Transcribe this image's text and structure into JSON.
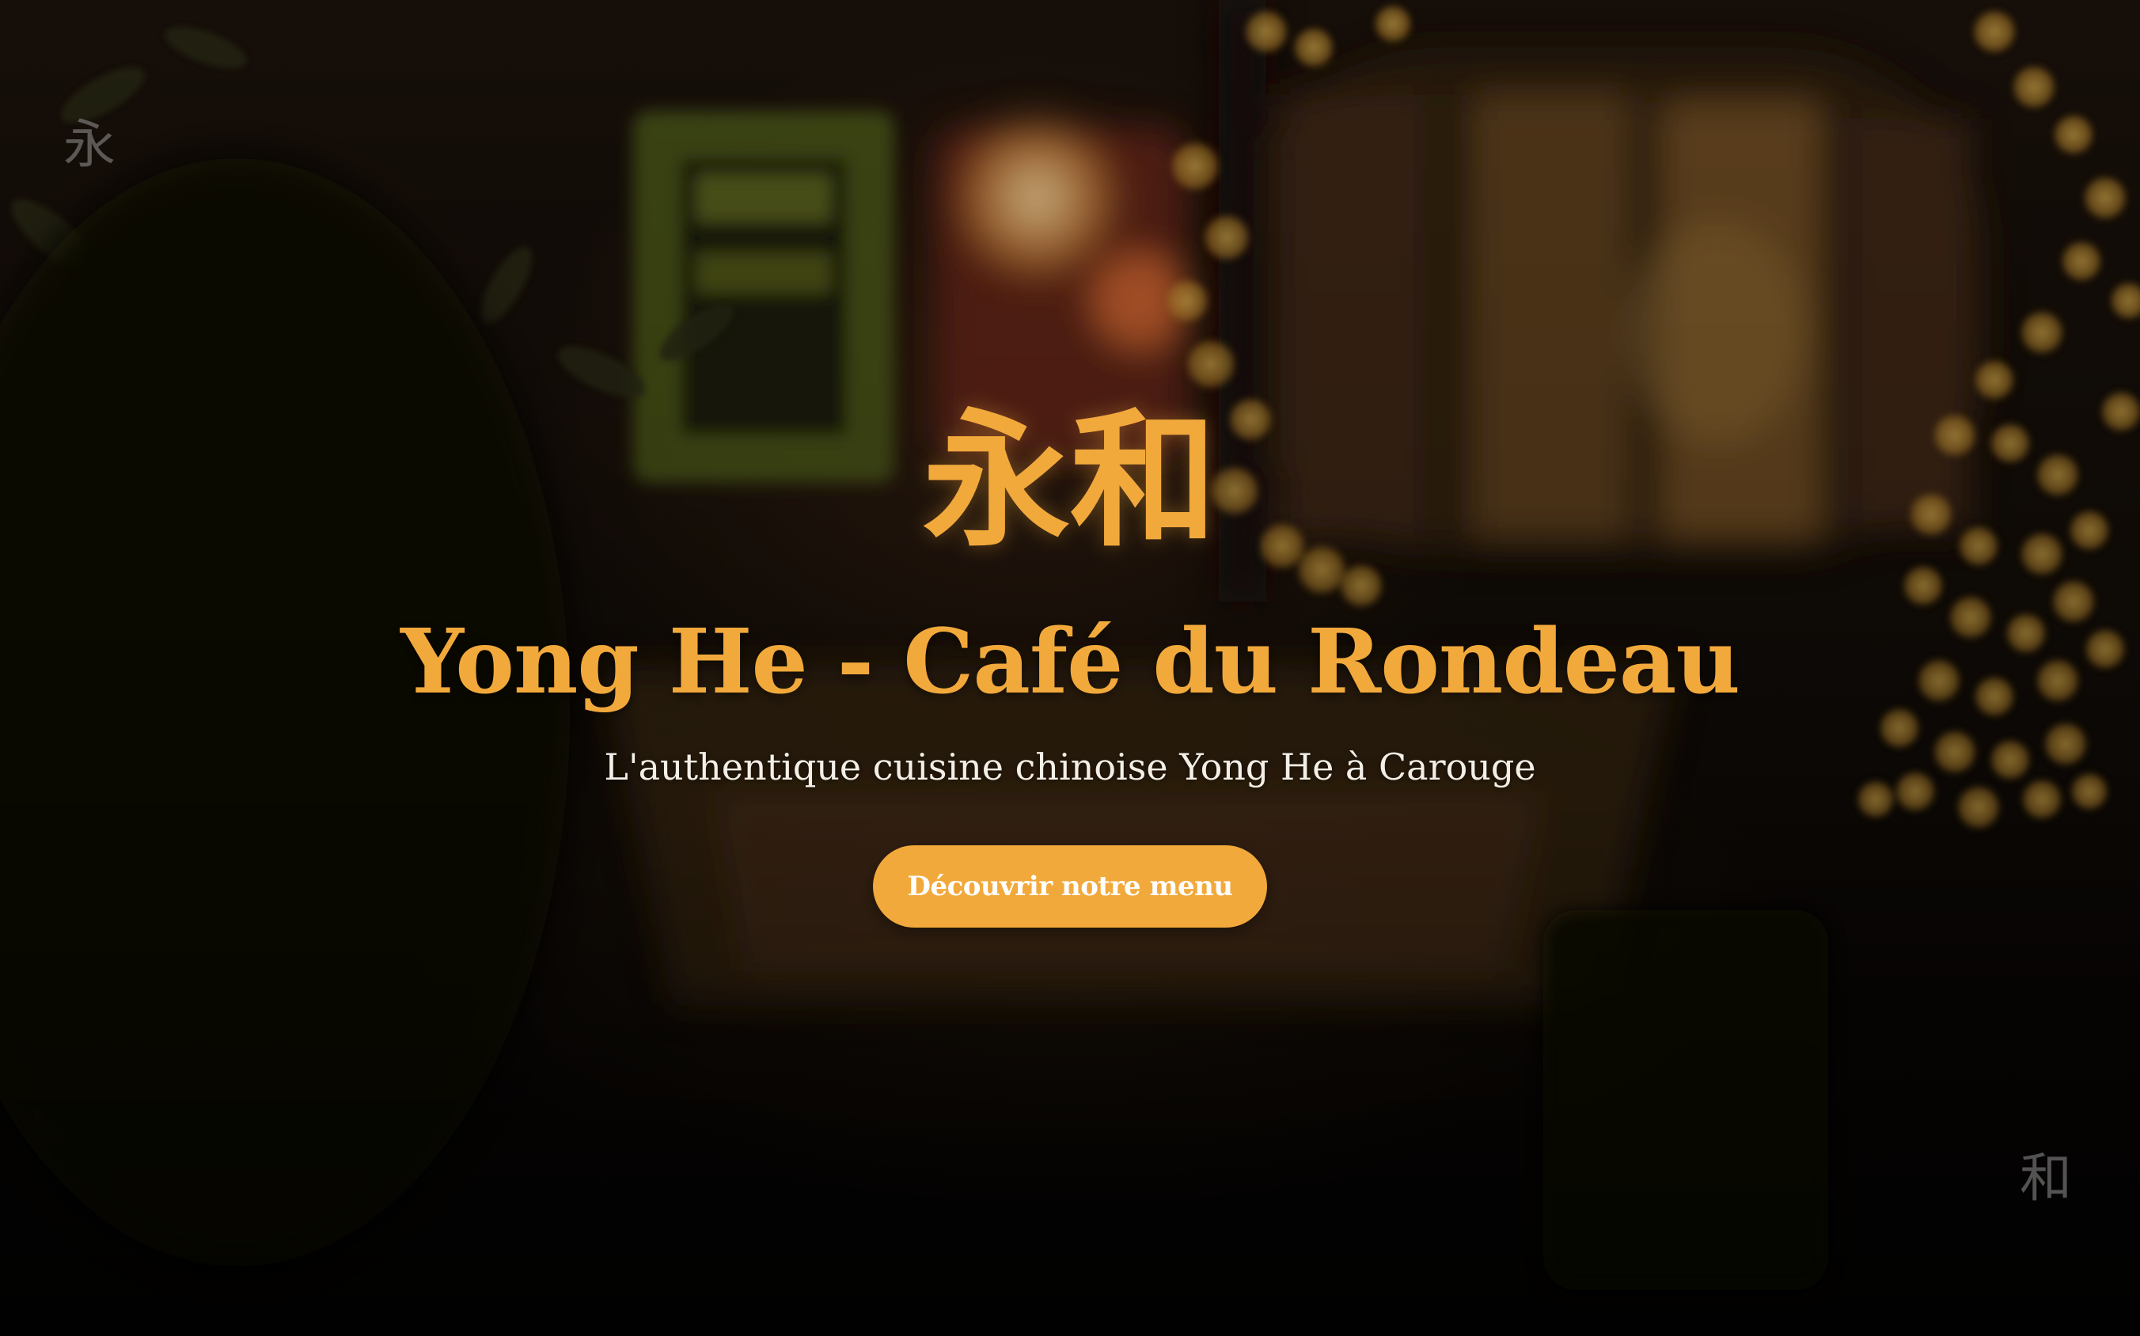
{
  "hero": {
    "logo_chinese": "永和",
    "title": "Yong He - Café du Rondeau",
    "subtitle": "L'authentique cuisine chinoise Yong He à Carouge",
    "cta_label": "Découvrir notre menu",
    "corner_glyph_left": "永",
    "corner_glyph_right": "和"
  },
  "colors": {
    "accent": "#f2a93b",
    "subtitle_text": "#f4efe6",
    "button_text": "#ffffff",
    "corner_glyph": "#969696"
  },
  "background": {
    "description_icon": "restaurant-night-bokeh-photo"
  }
}
